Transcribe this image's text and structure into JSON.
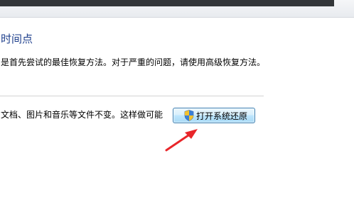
{
  "section": {
    "heading": "时间点",
    "description": "是首先尝试的最佳恢复方法。对于严重的问题，请使用高级恢复方法。"
  },
  "system_restore": {
    "description": "文档、图片和音乐等文件不变。这样做可能",
    "button_label": "打开系统还原",
    "button_icon": "uac-shield-icon"
  },
  "annotation": {
    "arrow_color": "#e8262a",
    "arrow_icon": "red-pointer-arrow"
  },
  "colors": {
    "heading": "#1e3f8c",
    "button_border": "#3c7fb1"
  }
}
